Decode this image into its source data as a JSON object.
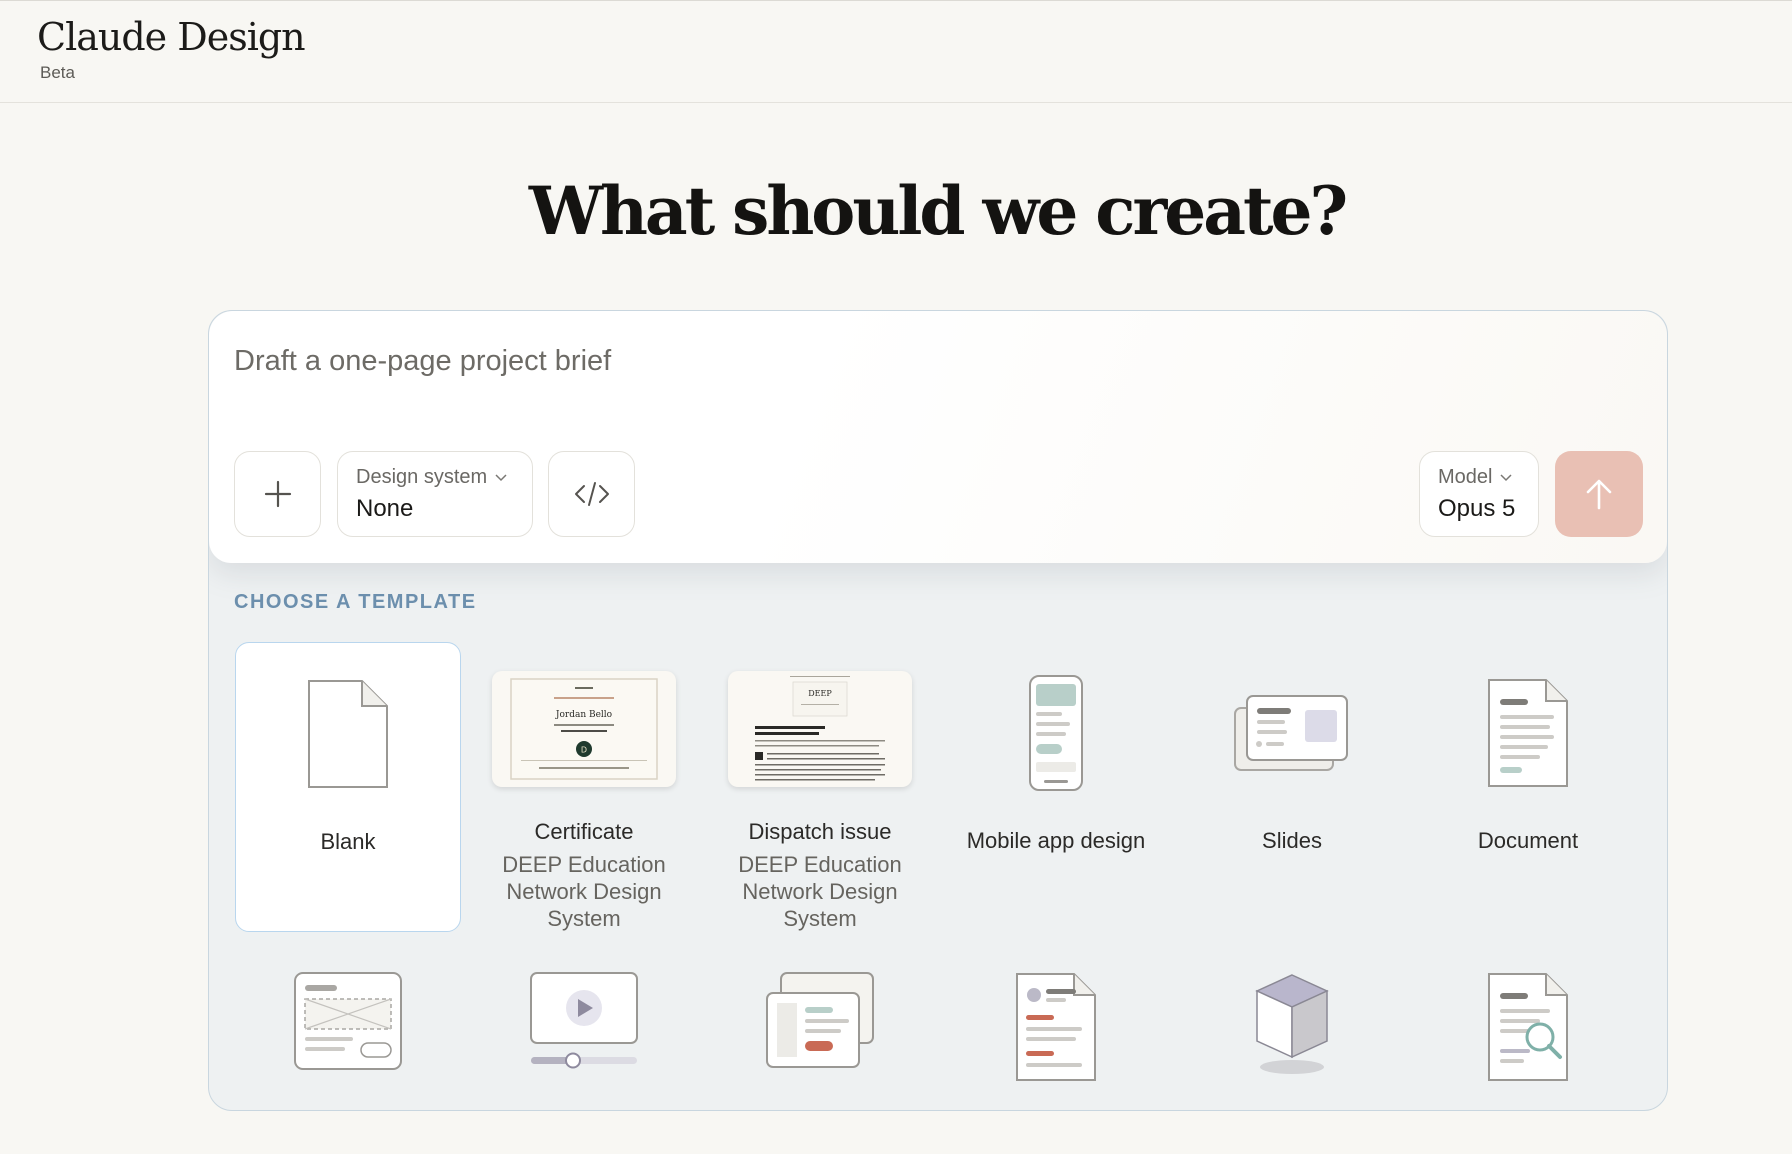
{
  "app": {
    "name": "Claude Design",
    "badge": "Beta"
  },
  "headline": "What should we create?",
  "prompt": {
    "placeholder": "Draft a one-page project brief"
  },
  "controls": {
    "design_system_label": "Design system",
    "design_system_value": "None",
    "model_label": "Model",
    "model_value": "Opus 5"
  },
  "templates": {
    "section_label": "CHOOSE A TEMPLATE",
    "items": [
      {
        "title": "Blank",
        "subtitle": ""
      },
      {
        "title": "Certificate",
        "subtitle": "DEEP Education Network Design System"
      },
      {
        "title": "Dispatch issue",
        "subtitle": "DEEP Education Network Design System"
      },
      {
        "title": "Mobile app design",
        "subtitle": ""
      },
      {
        "title": "Slides",
        "subtitle": ""
      },
      {
        "title": "Document",
        "subtitle": ""
      }
    ],
    "certificate_preview": {
      "name": "Jordan Bello",
      "seal": "D"
    },
    "dispatch_preview": {
      "masthead": "DEEP"
    }
  },
  "colors": {
    "background": "#f8f7f3",
    "accent_send": "#e9c0b4",
    "section_label": "#6c8fad",
    "selected_border": "#b9d6ee"
  },
  "icons": [
    "plus-icon",
    "chevron-down-icon",
    "code-icon",
    "arrow-up-icon"
  ]
}
